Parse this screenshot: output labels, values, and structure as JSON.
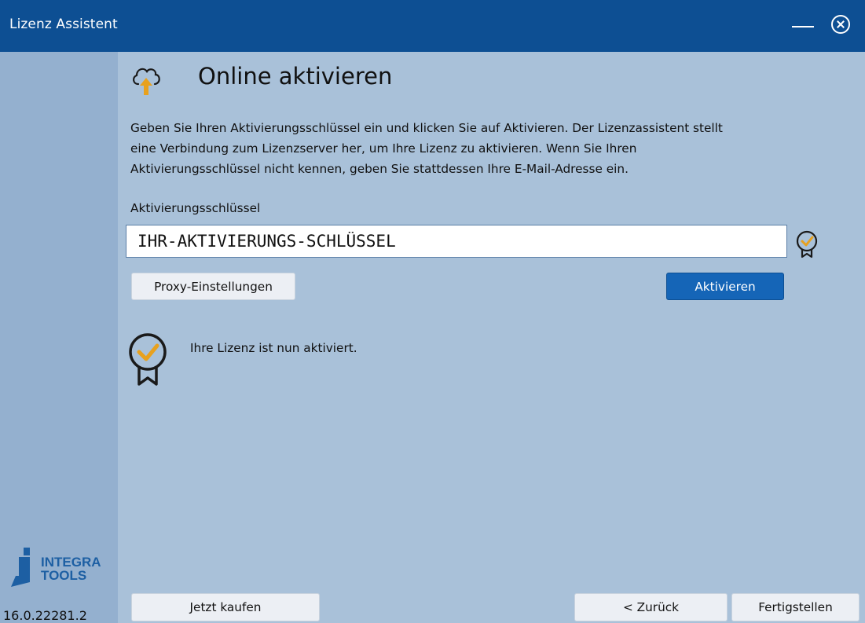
{
  "window": {
    "title": "Lizenz Assistent",
    "minimize_icon": "minimize-icon",
    "close_icon": "close-circle-icon"
  },
  "sidebar": {
    "logo_line1": "INTEGRA",
    "logo_line2": "TOOLS",
    "version": "16.0.22281.2"
  },
  "page": {
    "icon": "cloud-upload-icon",
    "title": "Online aktivieren",
    "intro_lines": [
      "Geben Sie Ihren Aktivierungsschlüssel ein und klicken Sie auf Aktivieren. Der Lizenzassistent stellt",
      "eine Verbindung zum Lizenzserver her, um Ihre Lizenz zu aktivieren. Wenn Sie Ihren",
      "Aktivierungsschlüssel nicht kennen, geben Sie stattdessen Ihre E-Mail-Adresse ein."
    ],
    "key_label": "Aktivierungsschlüssel",
    "key_value": "IHR-AKTIVIERUNGS-SCHLÜSSEL",
    "key_status_icon": "certificate-check-icon",
    "proxy_button": "Proxy-Einstellungen",
    "activate_button": "Aktivieren",
    "status_icon": "certificate-check-icon",
    "status_text": "Ihre Lizenz ist nun aktiviert."
  },
  "footer": {
    "buy_button": "Jetzt kaufen",
    "back_button": "< Zurück",
    "finish_button": "Fertigstellen"
  },
  "colors": {
    "titlebar": "#0d4f93",
    "background": "#a9c1d9",
    "sidebar": "#94b0cf",
    "accent": "#1565b7",
    "badge_orange": "#e8a11e"
  }
}
